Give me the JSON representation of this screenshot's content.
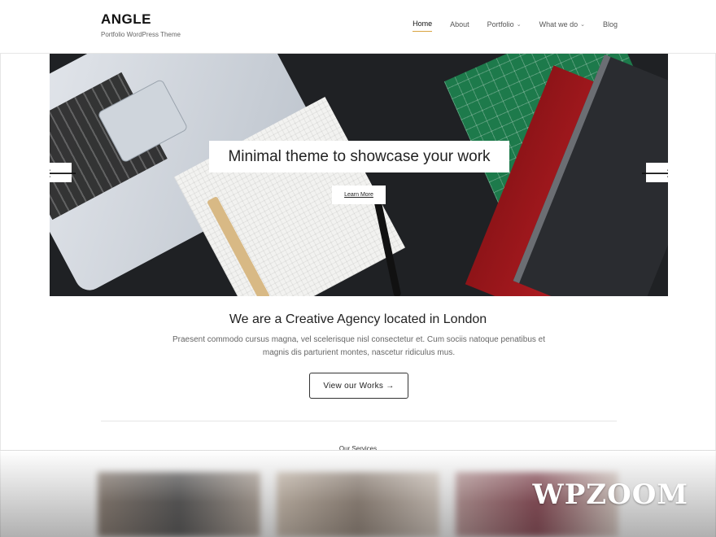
{
  "header": {
    "logo": "ANGLE",
    "tagline": "Portfolio WordPress Theme",
    "nav": [
      {
        "label": "Home",
        "active": true,
        "has_dropdown": false
      },
      {
        "label": "About",
        "active": false,
        "has_dropdown": false
      },
      {
        "label": "Portfolio",
        "active": false,
        "has_dropdown": true
      },
      {
        "label": "What we do",
        "active": false,
        "has_dropdown": true
      },
      {
        "label": "Blog",
        "active": false,
        "has_dropdown": false
      }
    ]
  },
  "hero": {
    "title": "Minimal theme to showcase your work",
    "button_label": "Learn More",
    "prev_icon": "arrow-left-icon",
    "next_icon": "arrow-right-icon"
  },
  "intro": {
    "title": "We are a Creative Agency located in London",
    "text": "Praesent commodo cursus magna, vel scelerisque nisl consectetur et. Cum sociis natoque penatibus et magnis dis parturient montes, nascetur ridiculus mus.",
    "button_label": "View our Works →"
  },
  "services": {
    "heading": "Our Services"
  },
  "watermark": {
    "brand": "WPZOOM"
  },
  "colors": {
    "accent": "#d9a441",
    "hero_bg": "#1f2124"
  }
}
